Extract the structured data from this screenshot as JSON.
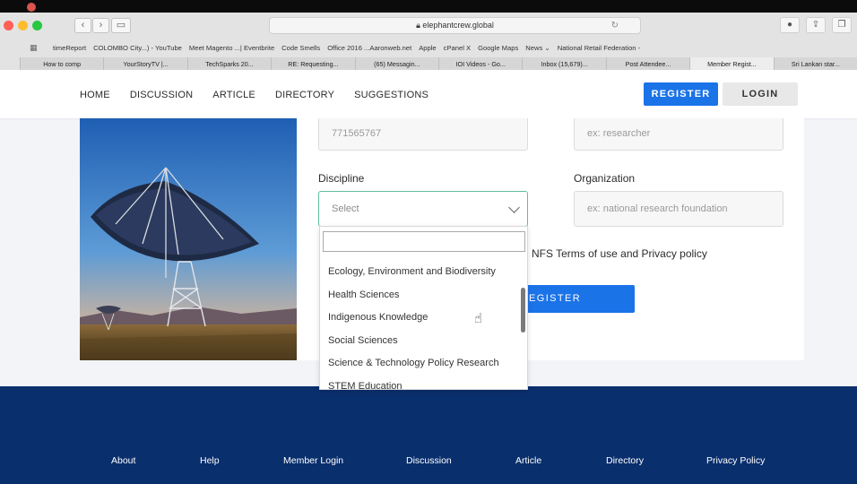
{
  "colors": {
    "primary_blue": "#1b73e8",
    "footer_navy": "#0a2f6d",
    "select_border_green": "#5dbf9a"
  },
  "browser": {
    "url": "elephantcrew.global",
    "bookmarks": [
      "timeReport",
      "COLOMBO City...) - YouTube",
      "Meet Magento ...| Eventbrite",
      "Code Smells",
      "Office 2016 ...Aaronweb.net",
      "Apple",
      "cPanel X",
      "Google Maps",
      "News ⌄",
      "National Retail Federation -"
    ],
    "tabs": [
      "How to comp",
      "YourStoryTV |...",
      "TechSparks 20...",
      "RE: Requesting...",
      "(65) Messagin...",
      "IOI Videos - Go...",
      "Inbox (15,679)...",
      "Post Attendee...",
      "Member Regist...",
      "Sri Lankan star..."
    ]
  },
  "header": {
    "nav": [
      "HOME",
      "DISCUSSION",
      "ARTICLE",
      "DIRECTORY",
      "SUGGESTIONS"
    ],
    "register_label": "REGISTER",
    "login_label": "LOGIN"
  },
  "form": {
    "phone_value": "771565767",
    "profession_placeholder": "ex: researcher",
    "discipline_label": "Discipline",
    "discipline_selected": "Select",
    "organization_label": "Organization",
    "organization_placeholder": "ex: national research foundation",
    "terms_text": "NFS Terms of use and Privacy policy",
    "register_button": "EGISTER"
  },
  "dropdown": {
    "search_value": "",
    "options": [
      "Ecology, Environment and Biodiversity",
      "Health Sciences",
      "Indigenous Knowledge",
      "Social Sciences",
      "Science & Technology Policy Research",
      "STEM Education"
    ]
  },
  "footer": {
    "links": [
      "About",
      "Help",
      "Member Login",
      "Discussion",
      "Article",
      "Directory",
      "Privacy Policy"
    ]
  }
}
